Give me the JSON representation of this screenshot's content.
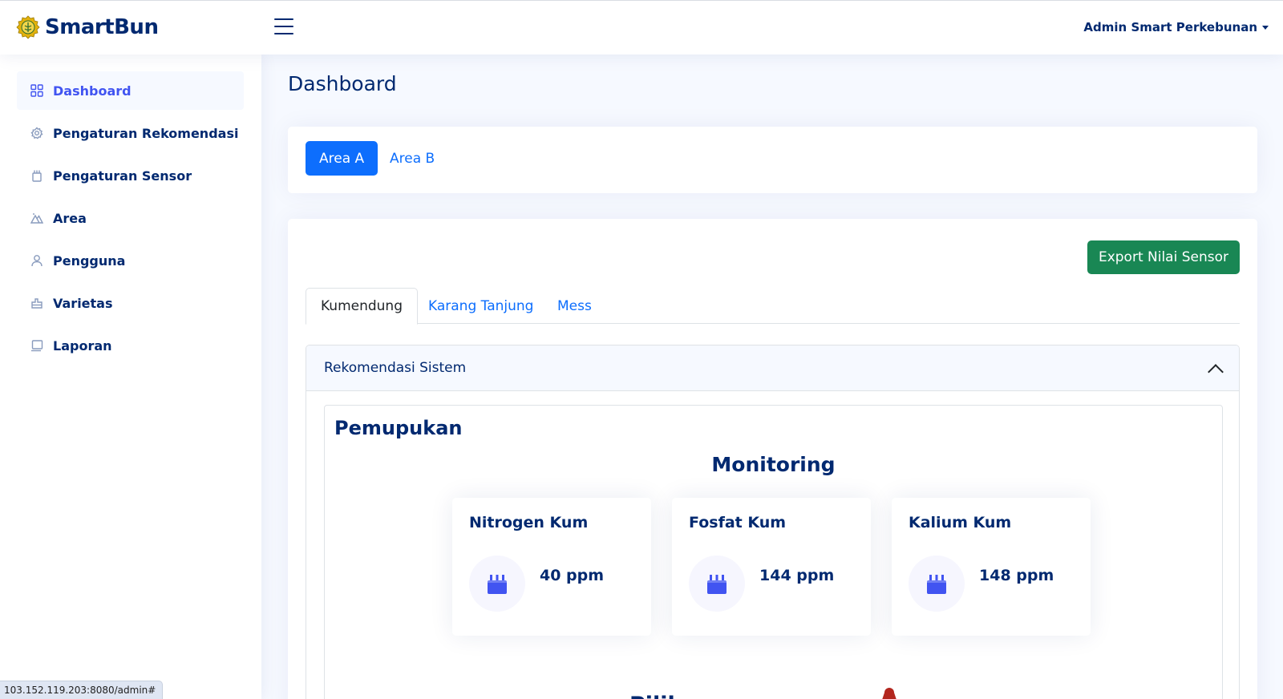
{
  "header": {
    "brand": "SmartBun",
    "user": "Admin Smart Perkebunan"
  },
  "sidebar": {
    "items": [
      {
        "label": "Dashboard",
        "icon": "grid-icon",
        "active": true
      },
      {
        "label": "Pengaturan Rekomendasi",
        "icon": "gear-icon"
      },
      {
        "label": "Pengaturan Sensor",
        "icon": "sensor-icon"
      },
      {
        "label": "Area",
        "icon": "mountain-icon"
      },
      {
        "label": "Pengguna",
        "icon": "person-icon"
      },
      {
        "label": "Varietas",
        "icon": "plant-icon"
      },
      {
        "label": "Laporan",
        "icon": "laptop-icon"
      }
    ]
  },
  "main": {
    "page_title": "Dashboard",
    "area_tabs": [
      "Area A",
      "Area B"
    ],
    "export_button": "Export Nilai Sensor",
    "location_tabs": [
      "Kumendung",
      "Karang Tanjung",
      "Mess"
    ],
    "accordion_title": "Rekomendasi Sistem",
    "section_title": "Pemupukan",
    "monitoring_title": "Monitoring",
    "metrics": [
      {
        "title": "Nitrogen Kum",
        "value": "40 ppm"
      },
      {
        "title": "Fosfat Kum",
        "value": "144 ppm"
      },
      {
        "title": "Kalium Kum",
        "value": "148 ppm"
      }
    ],
    "bottom_partial": "Pilih"
  },
  "status_url": "103.152.119.203:8080/admin#",
  "colors": {
    "primary": "#0d6efd",
    "navy": "#012970",
    "accent": "#4154f1",
    "success": "#198754"
  }
}
